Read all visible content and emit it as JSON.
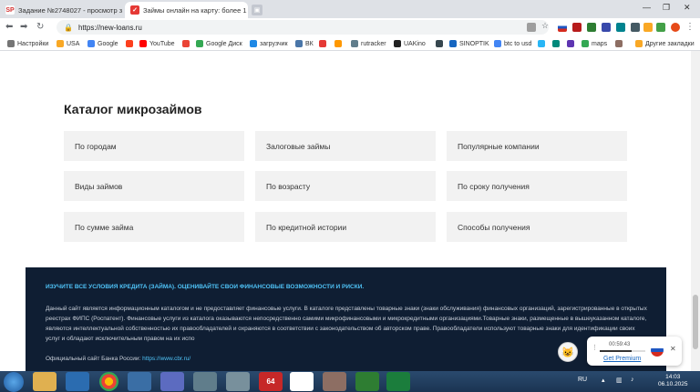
{
  "browser": {
    "tabs": [
      {
        "favicon_text": "SP",
        "title": "Задание №2748027 - просмотр з",
        "active": false
      },
      {
        "favicon_text": "✓",
        "title": "Займы онлайн на карту: более 1",
        "active": true
      }
    ],
    "url": "https://new-loans.ru",
    "bookmarks": [
      "Настройки",
      "USA",
      "Google",
      "",
      "YouTube",
      "",
      "Google Диск",
      "загрузчик",
      "ВК",
      "",
      "",
      "rutracker",
      "UAKino",
      "",
      "SINOPTIK",
      "btc to usd",
      "",
      "",
      "maps",
      "",
      "",
      "Другие закладки"
    ]
  },
  "page": {
    "catalog_title": "Каталог микрозаймов",
    "catalog_items": [
      "По городам",
      "Залоговые займы",
      "Популярные компании",
      "Виды займов",
      "По возрасту",
      "По сроку получения",
      "По сумме займа",
      "По кредитной истории",
      "Способы получения"
    ],
    "footer": {
      "headline": "ИЗУЧИТЕ ВСЕ УСЛОВИЯ КРЕДИТА (ЗАЙМА). ОЦЕНИВАЙТЕ СВОИ ФИНАНСОВЫЕ ВОЗМОЖНОСТИ И РИСКИ.",
      "paragraph": "Данный сайт является информационным каталогом и не предоставляет финансовые услуги. В каталоге представлены товарные знаки (знаки обслуживания) финансовых организаций, зарегистрированные в открытых реестрах ФИПС (Роспатент). Финансовые услуги из каталога оказываются непосредственно самими микрофинансовыми и микрокредитными организациями.Товарные знаки, размещенные в вышеуказанном каталоге, являются интеллектуальной собственностью их правообладателей и охраняются в соответствии с законодательством об авторском праве. Правообладатели используют товарные знаки для идентификации своих услуг и обладают исключительным правом на их испо",
      "cbr_label": "Официальный сайт Банка России:",
      "cbr_link": "https://www.cbr.ru/"
    }
  },
  "vpn_widget": {
    "timer": "00:59:43",
    "premium_label": "Get Premium",
    "progress": 0.7
  },
  "taskbar": {
    "lang": "RU",
    "time": "14:03",
    "date": "06.10.2025",
    "apps": [
      "64"
    ]
  },
  "colors": {
    "footer_bg": "#0f1e33",
    "accent": "#4fc3f7",
    "cell_bg": "#f2f2f2"
  }
}
